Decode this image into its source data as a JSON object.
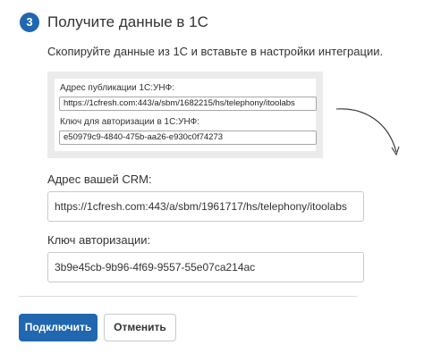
{
  "step": {
    "number": "3",
    "title": "Получите данные в 1С",
    "description": "Скопируйте данные из 1С и вставьте в настройки интеграции."
  },
  "example": {
    "publication_label": "Адрес публикации 1С:УНФ:",
    "publication_value": "https://1cfresh.com:443/a/sbm/1682215/hs/telephony/itoolabs",
    "auth_label": "Ключ для авторизации в 1С:УНФ:",
    "auth_value": "e50979c9-4840-475b-aa26-e930c0f74273"
  },
  "form": {
    "crm_address_label": "Адрес вашей CRM:",
    "crm_address_value": "https://1cfresh.com:443/a/sbm/1961717/hs/telephony/itoolabs",
    "auth_key_label": "Ключ авторизации:",
    "auth_key_value": "3b9e45cb-9b96-4f69-9557-55e07ca214ac"
  },
  "buttons": {
    "connect_label": "Подключить",
    "cancel_label": "Отменить"
  },
  "colors": {
    "accent": "#2067b0"
  }
}
